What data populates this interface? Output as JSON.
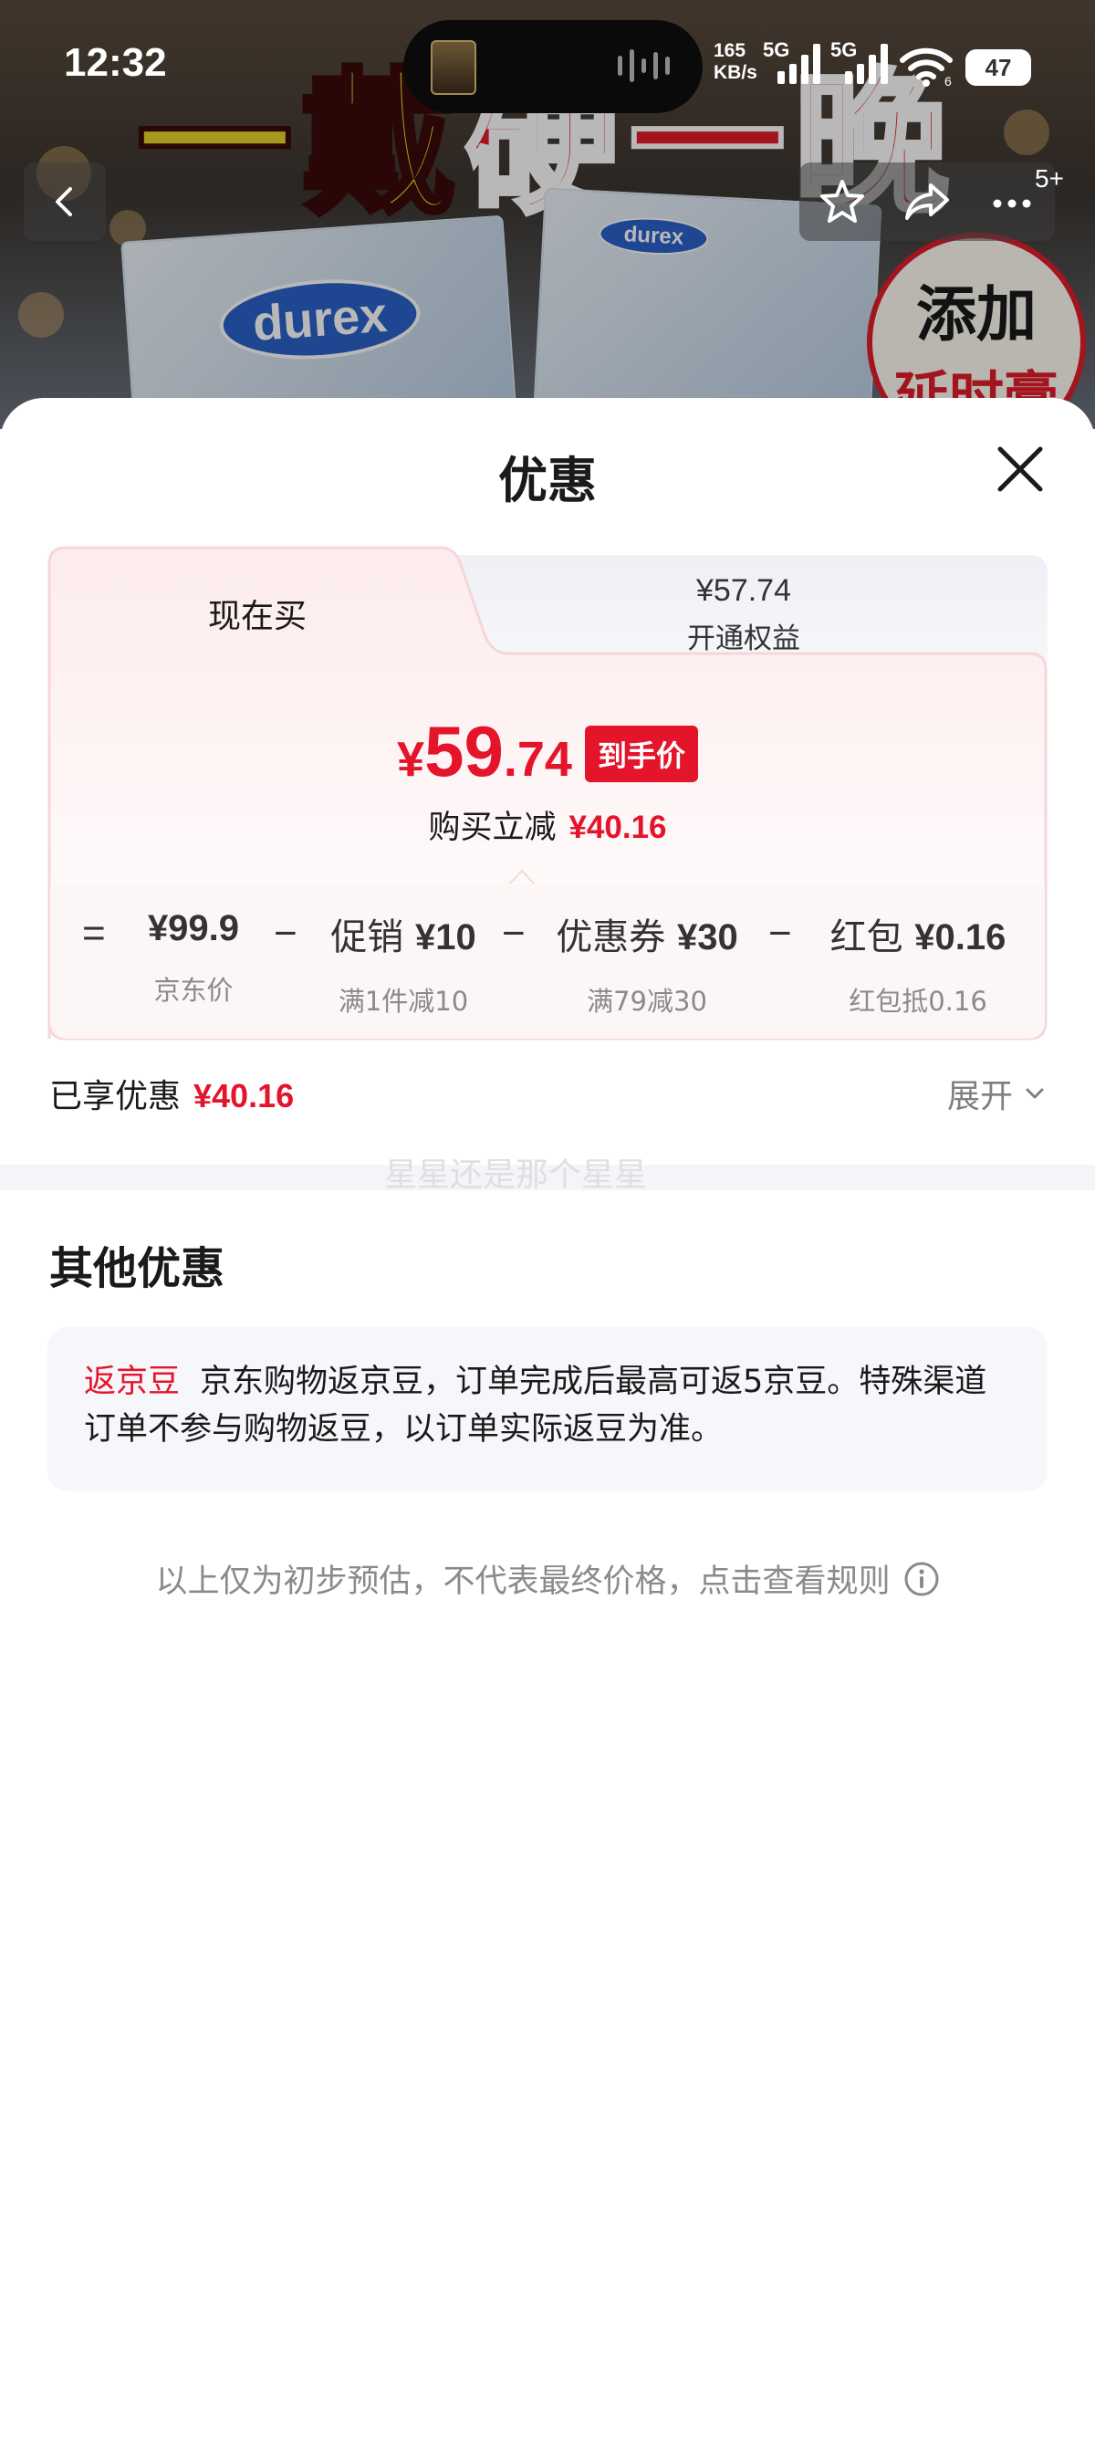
{
  "background": {
    "banner_text_1": "一戴",
    "banner_text_2": "硬一晚",
    "brand_logo": "durex",
    "sticker_line_1": "添加",
    "sticker_line_2": "延时膏"
  },
  "status_bar": {
    "time": "12:32",
    "net_speed_value": "165",
    "net_speed_unit": "KB/s",
    "sim1_label": "5G",
    "sim2_label": "5G",
    "wifi_sub": "6",
    "battery": "47",
    "battery_fraction": 0.47
  },
  "top_bar": {
    "more_count": "5+"
  },
  "sheet": {
    "title": "优惠",
    "tabs": [
      {
        "label": "现在买"
      },
      {
        "price": "¥57.74",
        "label": "开通权益"
      }
    ],
    "final_price": {
      "currency": "¥",
      "integer": "59",
      "decimal": ".74",
      "tag": "到手价"
    },
    "reduce": {
      "label": "购买立减",
      "amount": "¥40.16"
    },
    "breakdown": {
      "equals": "=",
      "minus": "−",
      "items": [
        {
          "name": "",
          "value": "¥99.9",
          "sub": "京东价"
        },
        {
          "name": "促销",
          "value": "¥10",
          "sub": "满1件减10"
        },
        {
          "name": "优惠券",
          "value": "¥30",
          "sub": "满79减30"
        },
        {
          "name": "红包",
          "value": "¥0.16",
          "sub": "红包抵0.16"
        }
      ]
    },
    "enjoyed": {
      "label": "已享优惠",
      "amount": "¥40.16",
      "expand_label": "展开"
    },
    "watermark": "星星还是那个星星",
    "other": {
      "title": "其他优惠",
      "tag": "返京豆",
      "text": "京东购物返京豆，订单完成后最高可返5京豆。特殊渠道订单不参与购物返豆，以订单实际返豆为准。"
    },
    "disclaimer": "以上仅为初步预估，不代表最终价格，点击查看规则"
  },
  "colors": {
    "accent_red": "#e4142b",
    "card_border": "#f7d6da",
    "muted_text": "#8a8a8a"
  },
  "icons": [
    "back-icon",
    "star-icon",
    "share-icon",
    "more-icon",
    "close-icon",
    "chevron-down-icon",
    "info-icon",
    "wifi-icon",
    "signal-icon",
    "audio-wave-icon"
  ]
}
